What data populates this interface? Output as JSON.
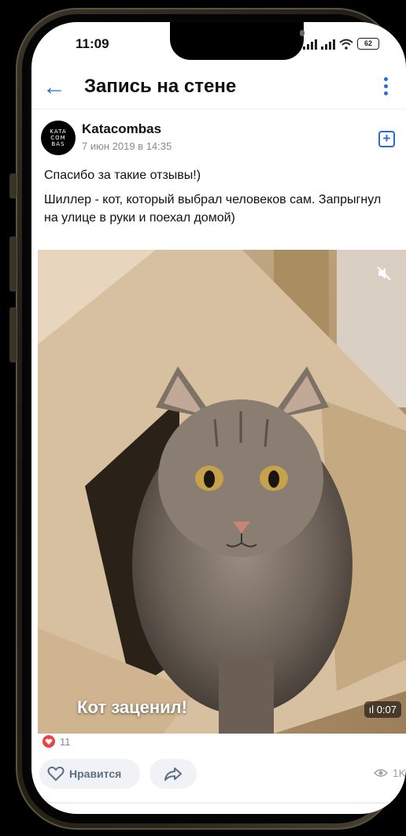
{
  "status_bar": {
    "time": "11:09",
    "battery": "62"
  },
  "header": {
    "title": "Запись на стене"
  },
  "post": {
    "author": "Katacombas",
    "avatar_text": [
      "KATA",
      "COM",
      "BAS"
    ],
    "date": "7 июн 2019 в 14:35",
    "text_1": "Спасибо за такие отзывы!)",
    "text_2": "Шиллер - кот, который выбрал человеков сам. Запрыгнул на улице в руки и поехал домой)"
  },
  "video": {
    "caption": "Кот заценил!",
    "duration": "0:07"
  },
  "reactions": {
    "likes": "11",
    "like_label": "Нравится",
    "views": "1K"
  },
  "colors": {
    "accent": "#2c6bd6",
    "like_red": "#e64646",
    "muted": "#818c99"
  },
  "icons": [
    "back-arrow-icon",
    "more-icon",
    "add-icon",
    "mute-icon",
    "equalizer-icon",
    "heart-icon",
    "share-icon",
    "eye-icon"
  ]
}
